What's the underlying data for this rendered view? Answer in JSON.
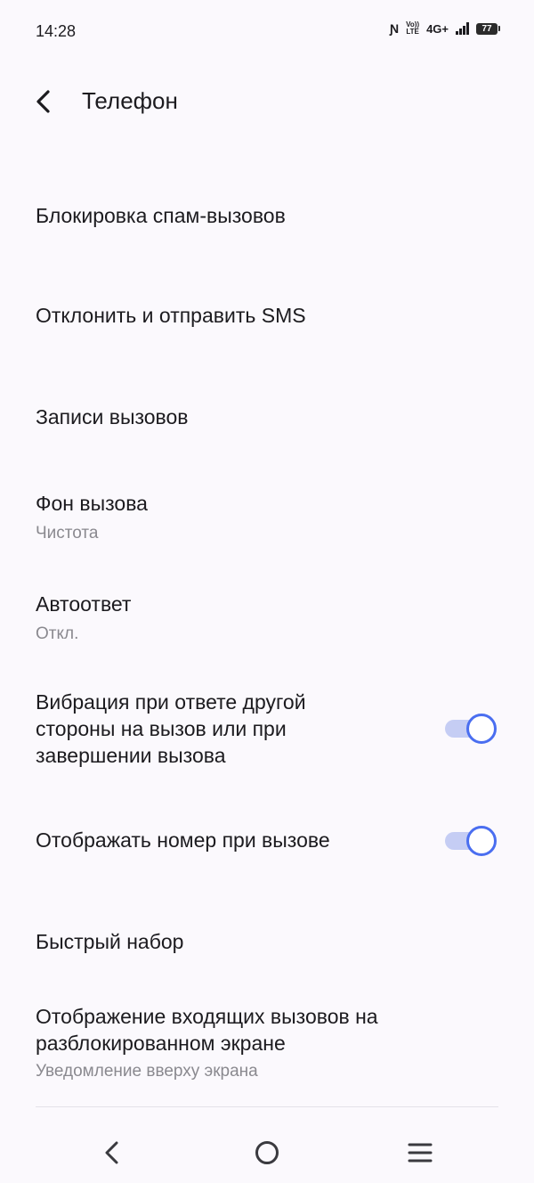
{
  "status_bar": {
    "time": "14:28",
    "volte_top": "Vo))",
    "volte_bottom": "LTE",
    "network": "4G+",
    "battery": "77",
    "icons": [
      "nfc-icon",
      "volte-icon",
      "signal-icon",
      "battery-icon"
    ]
  },
  "header": {
    "title": "Телефон",
    "back_icon": "chevron-left-icon"
  },
  "settings": {
    "spam_block": {
      "title": "Блокировка спам-вызовов"
    },
    "reject_sms": {
      "title": "Отклонить и отправить SMS"
    },
    "call_records": {
      "title": "Записи вызовов"
    },
    "call_background": {
      "title": "Фон вызова",
      "value": "Чистота"
    },
    "auto_answer": {
      "title": "Автоответ",
      "value": "Откл."
    },
    "vibration": {
      "title_line1": "Вибрация при ответе другой",
      "title_line2": "стороны на вызов или при",
      "title_line3": "завершении вызова",
      "enabled": true
    },
    "show_number": {
      "title": "Отображать номер при вызове",
      "enabled": true
    },
    "speed_dial": {
      "title": "Быстрый набор"
    },
    "incoming_display": {
      "title_line1": "Отображение входящих вызовов на",
      "title_line2": "разблокированном экране",
      "value": "Уведомление вверху экрана"
    }
  },
  "colors": {
    "background": "#fbf9fd",
    "accent": "#4a6ef0",
    "toggle_track": "#c5cdf4",
    "secondary_text": "#8a898f"
  },
  "nav_bar": {
    "buttons": [
      "back-nav-icon",
      "home-nav-icon",
      "menu-nav-icon"
    ]
  }
}
